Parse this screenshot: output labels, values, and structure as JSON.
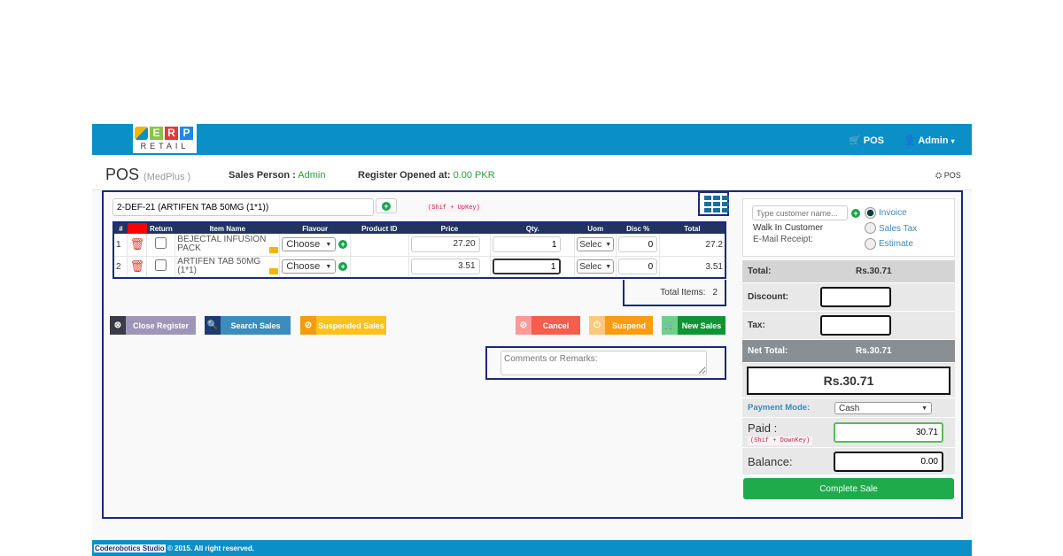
{
  "brand": {
    "logo_letters": [
      "E",
      "R",
      "P"
    ],
    "logo_sub": "RETAIL"
  },
  "nav": {
    "pos": "POS",
    "user": "Admin"
  },
  "header": {
    "title": "POS",
    "store": "(MedPlus  )",
    "sales_person_label": "Sales Person :",
    "sales_person": "Admin",
    "register_label": "Register Opened at:",
    "register_value": "0.00 PKR",
    "breadcrumb": "POS"
  },
  "search": {
    "value": "2-DEF-21 (ARTIFEN TAB 50MG (1*1))",
    "shortcut": "(Shif + UpKey)"
  },
  "table": {
    "headers": [
      "#",
      "",
      "Return",
      "Item Name",
      "Flavour",
      "Product ID",
      "Price",
      "Qty.",
      "Uom",
      "Disc %",
      "Total"
    ],
    "rows": [
      {
        "n": "1",
        "name": "BEJECTAL INFUSION PACK",
        "flavour": "Choose",
        "pid": "",
        "price": "27.20",
        "qty": "1",
        "uom": "Selec",
        "disc": "0",
        "total": "27.2"
      },
      {
        "n": "2",
        "name": "ARTIFEN TAB 50MG (1*1)",
        "flavour": "Choose",
        "pid": "",
        "price": "3.51",
        "qty": "1",
        "uom": "Selec",
        "disc": "0",
        "total": "3.51"
      }
    ]
  },
  "total_items": {
    "label": "Total Items:",
    "value": "2"
  },
  "buttons": {
    "close_register": "Close Register",
    "search_sales": "Search Sales",
    "suspended_sales": "Suspended Sales",
    "cancel": "Cancel",
    "suspend": "Suspend",
    "new_sales": "New Sales"
  },
  "comments": {
    "placeholder": "Comments or Remarks:"
  },
  "customer": {
    "placeholder": "Type customer name...",
    "walk_in": "Walk In Customer",
    "email": "E-Mail Receipt:",
    "types": [
      "Invoice",
      "Sales Tax",
      "Estimate"
    ],
    "selected": "Invoice"
  },
  "summary": {
    "total_label": "Total:",
    "total": "Rs.30.71",
    "discount_label": "Discount:",
    "tax_label": "Tax:",
    "net_label": "Net Total:",
    "net": "Rs.30.71",
    "big_total": "Rs.30.71",
    "payment_label": "Payment Mode:",
    "payment": "Cash",
    "paid_label": "Paid :",
    "paid_shortcut": "(Shif + DownKey)",
    "paid": "30.71",
    "balance_label": "Balance:",
    "balance": "0.00",
    "complete": "Complete Sale"
  },
  "footer": {
    "company": "Coderobotics Studio",
    "text": "© 2015. All right reserved."
  },
  "colors": {
    "header": "#0a8fc7",
    "navy": "#1b2a78",
    "green": "#1faa4c"
  }
}
